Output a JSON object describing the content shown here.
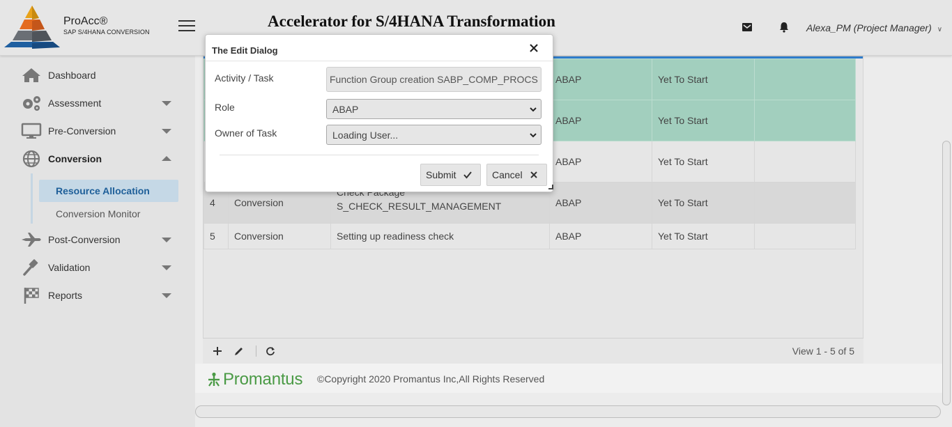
{
  "brand": {
    "name": "ProAcc®",
    "subtitle": "SAP S/4HANA CONVERSION"
  },
  "header": {
    "title": "Accelerator for S/4HANA Transformation",
    "user": "Alexa_PM (Project Manager)"
  },
  "sidebar": {
    "items": [
      {
        "label": "Dashboard",
        "icon": "home-icon"
      },
      {
        "label": "Assessment",
        "icon": "gears-icon"
      },
      {
        "label": "Pre-Conversion",
        "icon": "monitor-icon"
      },
      {
        "label": "Conversion",
        "icon": "globe-icon"
      },
      {
        "label": "Post-Conversion",
        "icon": "airplane-icon"
      },
      {
        "label": "Validation",
        "icon": "gavel-icon"
      },
      {
        "label": "Reports",
        "icon": "flag-icon"
      }
    ],
    "sub_items": [
      {
        "label": "Resource Allocation"
      },
      {
        "label": "Conversion Monitor"
      }
    ]
  },
  "grid": {
    "rows": [
      {
        "no": "",
        "phase": "",
        "task": "",
        "role": "ABAP",
        "status": "Yet To Start",
        "owner": ""
      },
      {
        "no": "",
        "phase": "",
        "task": "",
        "role": "ABAP",
        "status": "Yet To Start",
        "owner": ""
      },
      {
        "no": "",
        "phase": "",
        "task": "",
        "role": "ABAP",
        "status": "Yet To Start",
        "owner": ""
      },
      {
        "no": "4",
        "phase": "Conversion",
        "task_line1": "Check Package",
        "task_line2": "S_CHECK_RESULT_MANAGEMENT",
        "role": "ABAP",
        "status": "Yet To Start",
        "owner": ""
      },
      {
        "no": "5",
        "phase": "Conversion",
        "task": "Setting up readiness check",
        "role": "ABAP",
        "status": "Yet To Start",
        "owner": ""
      }
    ],
    "pager_view": "View 1 - 5 of 5"
  },
  "footer": {
    "logo_text": "Promantus",
    "copyright": "©Copyright 2020 Promantus Inc,All Rights Reserved"
  },
  "dialog": {
    "title": "The Edit Dialog",
    "activity_label": "Activity / Task",
    "activity_value": "Function Group creation SABP_COMP_PROCS",
    "role_label": "Role",
    "role_value": "ABAP",
    "owner_label": "Owner of Task",
    "owner_value": "Loading User...",
    "submit_label": "Submit",
    "cancel_label": "Cancel"
  },
  "colors": {
    "accent": "#2f7fd1",
    "selected_row": "#a2cfbe",
    "active_nav_bg": "#c5d8e6",
    "active_nav_text": "#1e5f99",
    "brand_green": "#4a9a45"
  }
}
